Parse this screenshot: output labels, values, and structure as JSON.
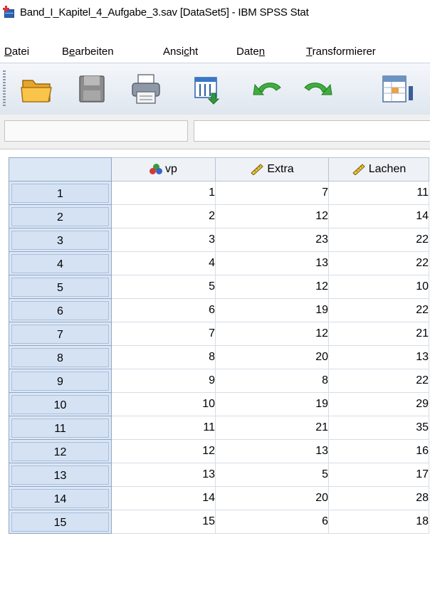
{
  "window": {
    "title": "Band_I_Kapitel_4_Aufgabe_3.sav [DataSet5] - IBM SPSS Stat"
  },
  "menu": [
    {
      "pre": "",
      "key": "D",
      "post": "atei"
    },
    {
      "pre": "B",
      "key": "e",
      "post": "arbeiten"
    },
    {
      "pre": "Ansi",
      "key": "c",
      "post": "ht"
    },
    {
      "pre": "Date",
      "key": "n",
      "post": ""
    },
    {
      "pre": "",
      "key": "T",
      "post": "ransformierer"
    }
  ],
  "toolbar": {
    "buttons": [
      "open-folder-icon",
      "save-disk-icon",
      "print-icon",
      "recall-dialog-icon",
      "undo-icon",
      "redo-icon",
      "goto-case-icon"
    ]
  },
  "cell_editor": {
    "name": "",
    "value": ""
  },
  "grid": {
    "columns": [
      {
        "name": "vp",
        "measure": "nominal"
      },
      {
        "name": "Extra",
        "measure": "scale"
      },
      {
        "name": "Lachen",
        "measure": "scale"
      }
    ],
    "rows": [
      {
        "n": "1",
        "vp": "1",
        "Extra": "7",
        "Lachen": "11"
      },
      {
        "n": "2",
        "vp": "2",
        "Extra": "12",
        "Lachen": "14"
      },
      {
        "n": "3",
        "vp": "3",
        "Extra": "23",
        "Lachen": "22"
      },
      {
        "n": "4",
        "vp": "4",
        "Extra": "13",
        "Lachen": "22"
      },
      {
        "n": "5",
        "vp": "5",
        "Extra": "12",
        "Lachen": "10"
      },
      {
        "n": "6",
        "vp": "6",
        "Extra": "19",
        "Lachen": "22"
      },
      {
        "n": "7",
        "vp": "7",
        "Extra": "12",
        "Lachen": "21"
      },
      {
        "n": "8",
        "vp": "8",
        "Extra": "20",
        "Lachen": "13"
      },
      {
        "n": "9",
        "vp": "9",
        "Extra": "8",
        "Lachen": "22"
      },
      {
        "n": "10",
        "vp": "10",
        "Extra": "19",
        "Lachen": "29"
      },
      {
        "n": "11",
        "vp": "11",
        "Extra": "21",
        "Lachen": "35"
      },
      {
        "n": "12",
        "vp": "12",
        "Extra": "13",
        "Lachen": "16"
      },
      {
        "n": "13",
        "vp": "13",
        "Extra": "5",
        "Lachen": "17"
      },
      {
        "n": "14",
        "vp": "14",
        "Extra": "20",
        "Lachen": "28"
      },
      {
        "n": "15",
        "vp": "15",
        "Extra": "6",
        "Lachen": "18"
      }
    ]
  }
}
